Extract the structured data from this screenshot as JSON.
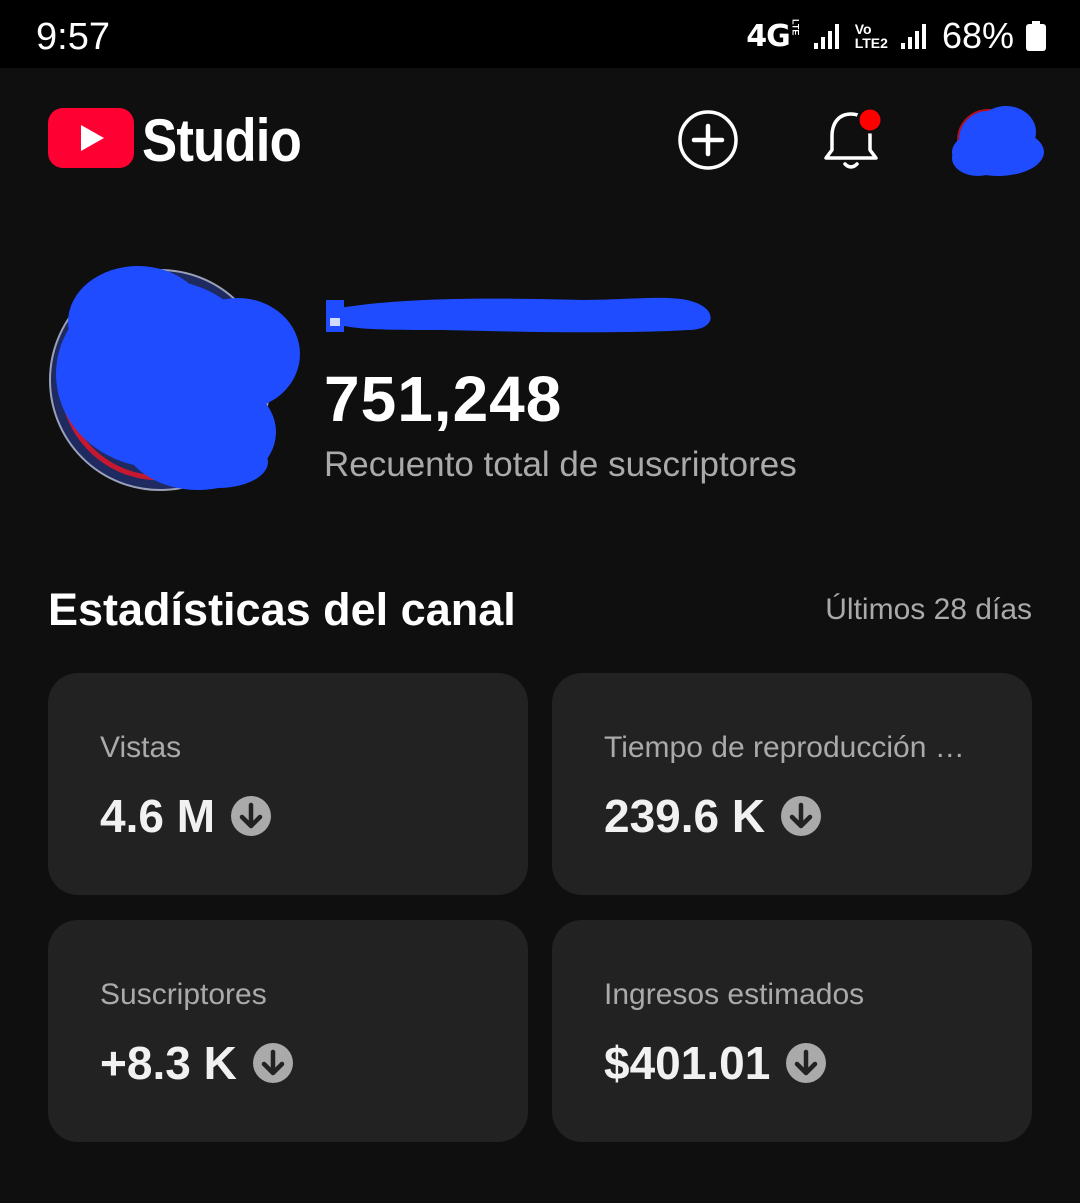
{
  "status_bar": {
    "time": "9:57",
    "network": "4G",
    "network_sub": "LTE",
    "volte_line1": "Vo",
    "volte_line2": "LTE2",
    "battery": "68%"
  },
  "header": {
    "app_name": "Studio",
    "brand_color": "#ff0033",
    "icons": [
      "create-icon",
      "notifications-icon",
      "account-avatar"
    ],
    "notification_dot_color": "#ff0000"
  },
  "channel": {
    "subscriber_count": "751,248",
    "subscriber_label": "Recuento total de suscriptores"
  },
  "stats": {
    "title": "Estadísticas del canal",
    "period": "Últimos 28 días",
    "cards": [
      {
        "label": "Vistas",
        "value": "4.6 M",
        "trend": "down"
      },
      {
        "label": "Tiempo de reproducción …",
        "value": "239.6 K",
        "trend": "down"
      },
      {
        "label": "Suscriptores",
        "value": "+8.3 K",
        "trend": "down"
      },
      {
        "label": "Ingresos estimados",
        "value": "$401.01",
        "trend": "down"
      }
    ]
  }
}
